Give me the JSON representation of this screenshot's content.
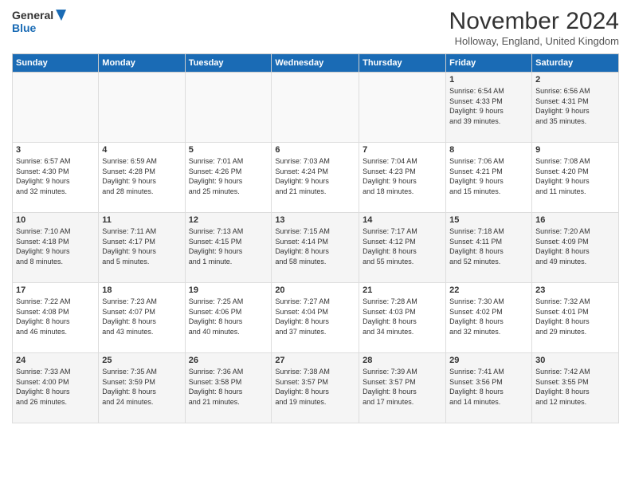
{
  "logo": {
    "line1": "General",
    "line2": "Blue"
  },
  "title": "November 2024",
  "location": "Holloway, England, United Kingdom",
  "weekdays": [
    "Sunday",
    "Monday",
    "Tuesday",
    "Wednesday",
    "Thursday",
    "Friday",
    "Saturday"
  ],
  "weeks": [
    [
      {
        "day": "",
        "info": ""
      },
      {
        "day": "",
        "info": ""
      },
      {
        "day": "",
        "info": ""
      },
      {
        "day": "",
        "info": ""
      },
      {
        "day": "",
        "info": ""
      },
      {
        "day": "1",
        "info": "Sunrise: 6:54 AM\nSunset: 4:33 PM\nDaylight: 9 hours\nand 39 minutes."
      },
      {
        "day": "2",
        "info": "Sunrise: 6:56 AM\nSunset: 4:31 PM\nDaylight: 9 hours\nand 35 minutes."
      }
    ],
    [
      {
        "day": "3",
        "info": "Sunrise: 6:57 AM\nSunset: 4:30 PM\nDaylight: 9 hours\nand 32 minutes."
      },
      {
        "day": "4",
        "info": "Sunrise: 6:59 AM\nSunset: 4:28 PM\nDaylight: 9 hours\nand 28 minutes."
      },
      {
        "day": "5",
        "info": "Sunrise: 7:01 AM\nSunset: 4:26 PM\nDaylight: 9 hours\nand 25 minutes."
      },
      {
        "day": "6",
        "info": "Sunrise: 7:03 AM\nSunset: 4:24 PM\nDaylight: 9 hours\nand 21 minutes."
      },
      {
        "day": "7",
        "info": "Sunrise: 7:04 AM\nSunset: 4:23 PM\nDaylight: 9 hours\nand 18 minutes."
      },
      {
        "day": "8",
        "info": "Sunrise: 7:06 AM\nSunset: 4:21 PM\nDaylight: 9 hours\nand 15 minutes."
      },
      {
        "day": "9",
        "info": "Sunrise: 7:08 AM\nSunset: 4:20 PM\nDaylight: 9 hours\nand 11 minutes."
      }
    ],
    [
      {
        "day": "10",
        "info": "Sunrise: 7:10 AM\nSunset: 4:18 PM\nDaylight: 9 hours\nand 8 minutes."
      },
      {
        "day": "11",
        "info": "Sunrise: 7:11 AM\nSunset: 4:17 PM\nDaylight: 9 hours\nand 5 minutes."
      },
      {
        "day": "12",
        "info": "Sunrise: 7:13 AM\nSunset: 4:15 PM\nDaylight: 9 hours\nand 1 minute."
      },
      {
        "day": "13",
        "info": "Sunrise: 7:15 AM\nSunset: 4:14 PM\nDaylight: 8 hours\nand 58 minutes."
      },
      {
        "day": "14",
        "info": "Sunrise: 7:17 AM\nSunset: 4:12 PM\nDaylight: 8 hours\nand 55 minutes."
      },
      {
        "day": "15",
        "info": "Sunrise: 7:18 AM\nSunset: 4:11 PM\nDaylight: 8 hours\nand 52 minutes."
      },
      {
        "day": "16",
        "info": "Sunrise: 7:20 AM\nSunset: 4:09 PM\nDaylight: 8 hours\nand 49 minutes."
      }
    ],
    [
      {
        "day": "17",
        "info": "Sunrise: 7:22 AM\nSunset: 4:08 PM\nDaylight: 8 hours\nand 46 minutes."
      },
      {
        "day": "18",
        "info": "Sunrise: 7:23 AM\nSunset: 4:07 PM\nDaylight: 8 hours\nand 43 minutes."
      },
      {
        "day": "19",
        "info": "Sunrise: 7:25 AM\nSunset: 4:06 PM\nDaylight: 8 hours\nand 40 minutes."
      },
      {
        "day": "20",
        "info": "Sunrise: 7:27 AM\nSunset: 4:04 PM\nDaylight: 8 hours\nand 37 minutes."
      },
      {
        "day": "21",
        "info": "Sunrise: 7:28 AM\nSunset: 4:03 PM\nDaylight: 8 hours\nand 34 minutes."
      },
      {
        "day": "22",
        "info": "Sunrise: 7:30 AM\nSunset: 4:02 PM\nDaylight: 8 hours\nand 32 minutes."
      },
      {
        "day": "23",
        "info": "Sunrise: 7:32 AM\nSunset: 4:01 PM\nDaylight: 8 hours\nand 29 minutes."
      }
    ],
    [
      {
        "day": "24",
        "info": "Sunrise: 7:33 AM\nSunset: 4:00 PM\nDaylight: 8 hours\nand 26 minutes."
      },
      {
        "day": "25",
        "info": "Sunrise: 7:35 AM\nSunset: 3:59 PM\nDaylight: 8 hours\nand 24 minutes."
      },
      {
        "day": "26",
        "info": "Sunrise: 7:36 AM\nSunset: 3:58 PM\nDaylight: 8 hours\nand 21 minutes."
      },
      {
        "day": "27",
        "info": "Sunrise: 7:38 AM\nSunset: 3:57 PM\nDaylight: 8 hours\nand 19 minutes."
      },
      {
        "day": "28",
        "info": "Sunrise: 7:39 AM\nSunset: 3:57 PM\nDaylight: 8 hours\nand 17 minutes."
      },
      {
        "day": "29",
        "info": "Sunrise: 7:41 AM\nSunset: 3:56 PM\nDaylight: 8 hours\nand 14 minutes."
      },
      {
        "day": "30",
        "info": "Sunrise: 7:42 AM\nSunset: 3:55 PM\nDaylight: 8 hours\nand 12 minutes."
      }
    ]
  ]
}
